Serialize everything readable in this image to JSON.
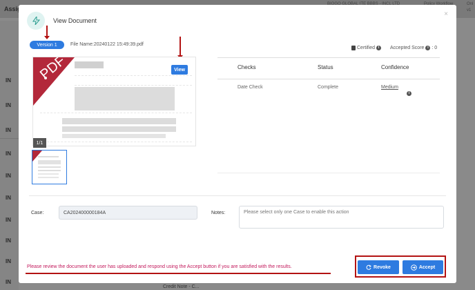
{
  "background": {
    "tab": "Assign",
    "right_texts": [
      "BIOGO GLOBAL ITE BBBS - INCL LTD",
      "Policy Workflow",
      "Onl",
      "v1"
    ],
    "rows": [
      "IN",
      "IN",
      "IN",
      "IN",
      "IN",
      "IN",
      "IN",
      "IN",
      "IN",
      "IN",
      "IN"
    ],
    "bottom_text": "Credit Note - C..."
  },
  "modal": {
    "title": "View Document",
    "icon": "lightning-icon",
    "close_label": "×",
    "version_label": "Version 1",
    "file_label": "File Name:",
    "file_name": "20240122 15:49:39.pdf",
    "view_button": "View",
    "page_indicator": "1/1",
    "certified_label": "Certified",
    "accepted_score_label": "Accepted Score",
    "accepted_score_value": ": 0",
    "table": {
      "headers": [
        "Checks",
        "Status",
        "Confidence"
      ],
      "rows": [
        {
          "check": "Date Check",
          "status": "Complete",
          "confidence": "Medium"
        }
      ]
    },
    "case_label": "Case:",
    "case_value": "CA202400000184A",
    "notes_label": "Notes:",
    "notes_placeholder": "Please select only one Case to enable this action",
    "instruction": "Please review the document the user has uploaded and respond using the Accept button if you are satisfied with the results.",
    "revoke_button": "Revoke",
    "accept_button": "Accept"
  },
  "colors": {
    "primary": "#2e7be0",
    "annotation_red": "#b31212",
    "instruction_text": "#c2185b"
  }
}
